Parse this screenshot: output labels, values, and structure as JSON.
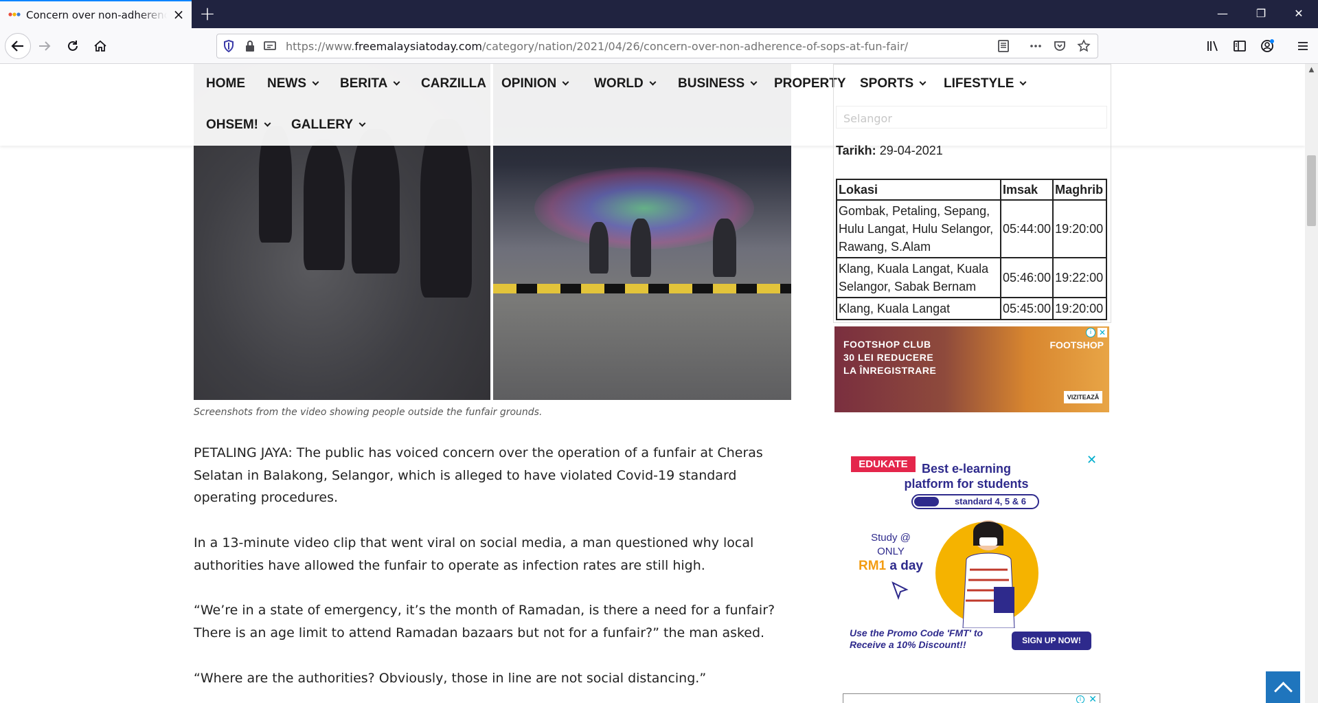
{
  "browser": {
    "tab_title": "Concern over non-adherence of SOPs at fun fair",
    "new_tab": "+",
    "url_host": "freemalaysiatoday.com",
    "url_prefix": "https://www.",
    "url_path": "/category/nation/2021/04/26/concern-over-non-adherence-of-sops-at-fun-fair/",
    "window": {
      "minimize": "—",
      "restore": "❐",
      "close": "✕"
    },
    "icons": [
      "back-icon",
      "forward-icon",
      "reload-icon",
      "home-icon",
      "shield-icon",
      "lock-icon",
      "permissions-icon",
      "reader-view-icon",
      "more-icon",
      "pocket-icon",
      "star-icon",
      "library-icon",
      "sidebar-icon",
      "account-icon",
      "menu-icon"
    ]
  },
  "site_nav": {
    "items": [
      {
        "label": "HOME",
        "dropdown": false
      },
      {
        "label": "NEWS",
        "dropdown": true
      },
      {
        "label": "BERITA",
        "dropdown": true
      },
      {
        "label": "CARZILLA",
        "dropdown": false
      },
      {
        "label": "OPINION",
        "dropdown": true
      },
      {
        "label": "WORLD",
        "dropdown": true
      },
      {
        "label": "BUSINESS",
        "dropdown": true
      },
      {
        "label": "PROPERTY",
        "dropdown": false
      },
      {
        "label": "SPORTS",
        "dropdown": true
      },
      {
        "label": "LIFESTYLE",
        "dropdown": true
      },
      {
        "label": "OHSEM!",
        "dropdown": true
      },
      {
        "label": "GALLERY",
        "dropdown": true
      }
    ]
  },
  "article": {
    "caption": "Screenshots from the video showing people outside the funfair grounds.",
    "paragraphs": [
      "PETALING JAYA: The public has voiced concern over the operation of a funfair at Cheras Selatan in Balakong, Selangor, which is alleged to have violated Covid-19 standard operating procedures.",
      "In a 13-minute video clip that went viral on social media, a man questioned why local authorities have allowed the funfair to operate as infection rates are still high.",
      "“We’re in a state of emergency, it’s the month of Ramadan, is there a need for a funfair? There is an age limit to attend Ramadan bazaars but not for a funfair?” the man asked.",
      "“Where are the authorities? Obviously, those in line are not social distancing.”"
    ]
  },
  "prayer_times": {
    "state_select": "Selangor",
    "date_label": "Tarikh:",
    "date_value": "29-04-2021",
    "headers": [
      "Lokasi",
      "Imsak",
      "Maghrib"
    ],
    "rows": [
      [
        "Gombak, Petaling, Sepang, Hulu Langat, Hulu Selangor, Rawang, S.Alam",
        "05:44:00",
        "19:20:00"
      ],
      [
        "Klang, Kuala Langat, Kuala Selangor, Sabak Bernam",
        "05:46:00",
        "19:22:00"
      ],
      [
        "Klang, Kuala Langat",
        "05:45:00",
        "19:20:00"
      ]
    ]
  },
  "ads": {
    "footshop": {
      "text_lines": [
        "FOOTSHOP CLUB",
        "30 LEI REDUCERE",
        "LA ÎNREGISTRARE"
      ],
      "brand": "FOOTSHOP",
      "cta": "VIZITEAZĂ"
    },
    "edukate": {
      "logo": "EDUKATE",
      "headline": "Best e-learning platform for students",
      "pill": "standard 4, 5 & 6",
      "study": "Study @ ONLY",
      "price_rm": "RM1",
      "price_rest": " a day",
      "promo": "Use the Promo Code 'FMT' to Receive a 10% Discount!!",
      "cta": "SIGN UP NOW!"
    }
  },
  "colors": {
    "tabbar": "#202340",
    "accent": "#0a84ff",
    "to_top": "#1f75bd",
    "edukate_blue": "#2e2a8c",
    "edukate_red": "#e4264b"
  }
}
